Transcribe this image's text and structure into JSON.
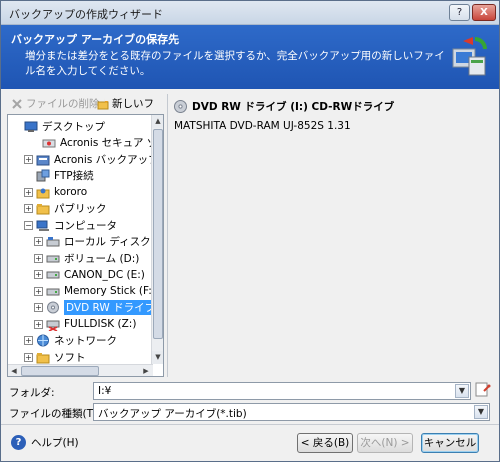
{
  "window": {
    "title": "バックアップの作成ウィザード",
    "help_btn": "?",
    "close_btn": "X"
  },
  "header": {
    "title": "バックアップ アーカイブの保存先",
    "description": "増分または差分をとる既存のファイルを選択するか、完全バックアップ用の新しいファイル名を入力してください。"
  },
  "toolbar": {
    "delete_label": "ファイルの削除",
    "new_label": "新しいフ"
  },
  "tree": {
    "items": [
      {
        "label": "デスクトップ",
        "expander": "",
        "icon": "desktop-icon"
      },
      {
        "label": "Acronis セキュア ゾーン",
        "expander": "",
        "icon": "secure-zone-icon"
      },
      {
        "label": "Acronis バックアップ ロケーション",
        "expander": "+",
        "icon": "backup-location-icon"
      },
      {
        "label": "FTP接続",
        "expander": "",
        "icon": "ftp-icon"
      },
      {
        "label": "kororo",
        "expander": "+",
        "icon": "user-folder-icon"
      },
      {
        "label": "パブリック",
        "expander": "+",
        "icon": "folder-icon"
      },
      {
        "label": "コンピュータ",
        "expander": "−",
        "icon": "computer-icon"
      },
      {
        "label": "ローカル ディスク (C:)",
        "expander": "+",
        "icon": "local-disk-icon"
      },
      {
        "label": "ボリューム (D:)",
        "expander": "+",
        "icon": "drive-icon"
      },
      {
        "label": "CANON_DC (E:)",
        "expander": "+",
        "icon": "drive-icon"
      },
      {
        "label": "Memory Stick (F:)",
        "expander": "+",
        "icon": "drive-icon"
      },
      {
        "label": "DVD RW ドライブ (I:)",
        "expander": "+",
        "icon": "dvd-drive-icon"
      },
      {
        "label": "FULLDISK (Z:)",
        "expander": "+",
        "icon": "network-drive-icon"
      },
      {
        "label": "ネットワーク",
        "expander": "+",
        "icon": "network-icon"
      },
      {
        "label": "ソフト",
        "expander": "+",
        "icon": "folder-icon"
      }
    ]
  },
  "info": {
    "title": "DVD RW ドライブ (I:) CD-RWドライブ",
    "model": "MATSHITA DVD-RAM UJ-852S 1.31"
  },
  "form": {
    "folder_label": "フォルダ:",
    "folder_value": "I:¥",
    "type_label": "ファイルの種類(T):",
    "type_value": "バックアップ アーカイブ(*.tib)"
  },
  "footer": {
    "help": "ヘルプ(H)",
    "back": "< 戻る(B)",
    "next": "次へ(N) >",
    "cancel": "キャンセル"
  }
}
